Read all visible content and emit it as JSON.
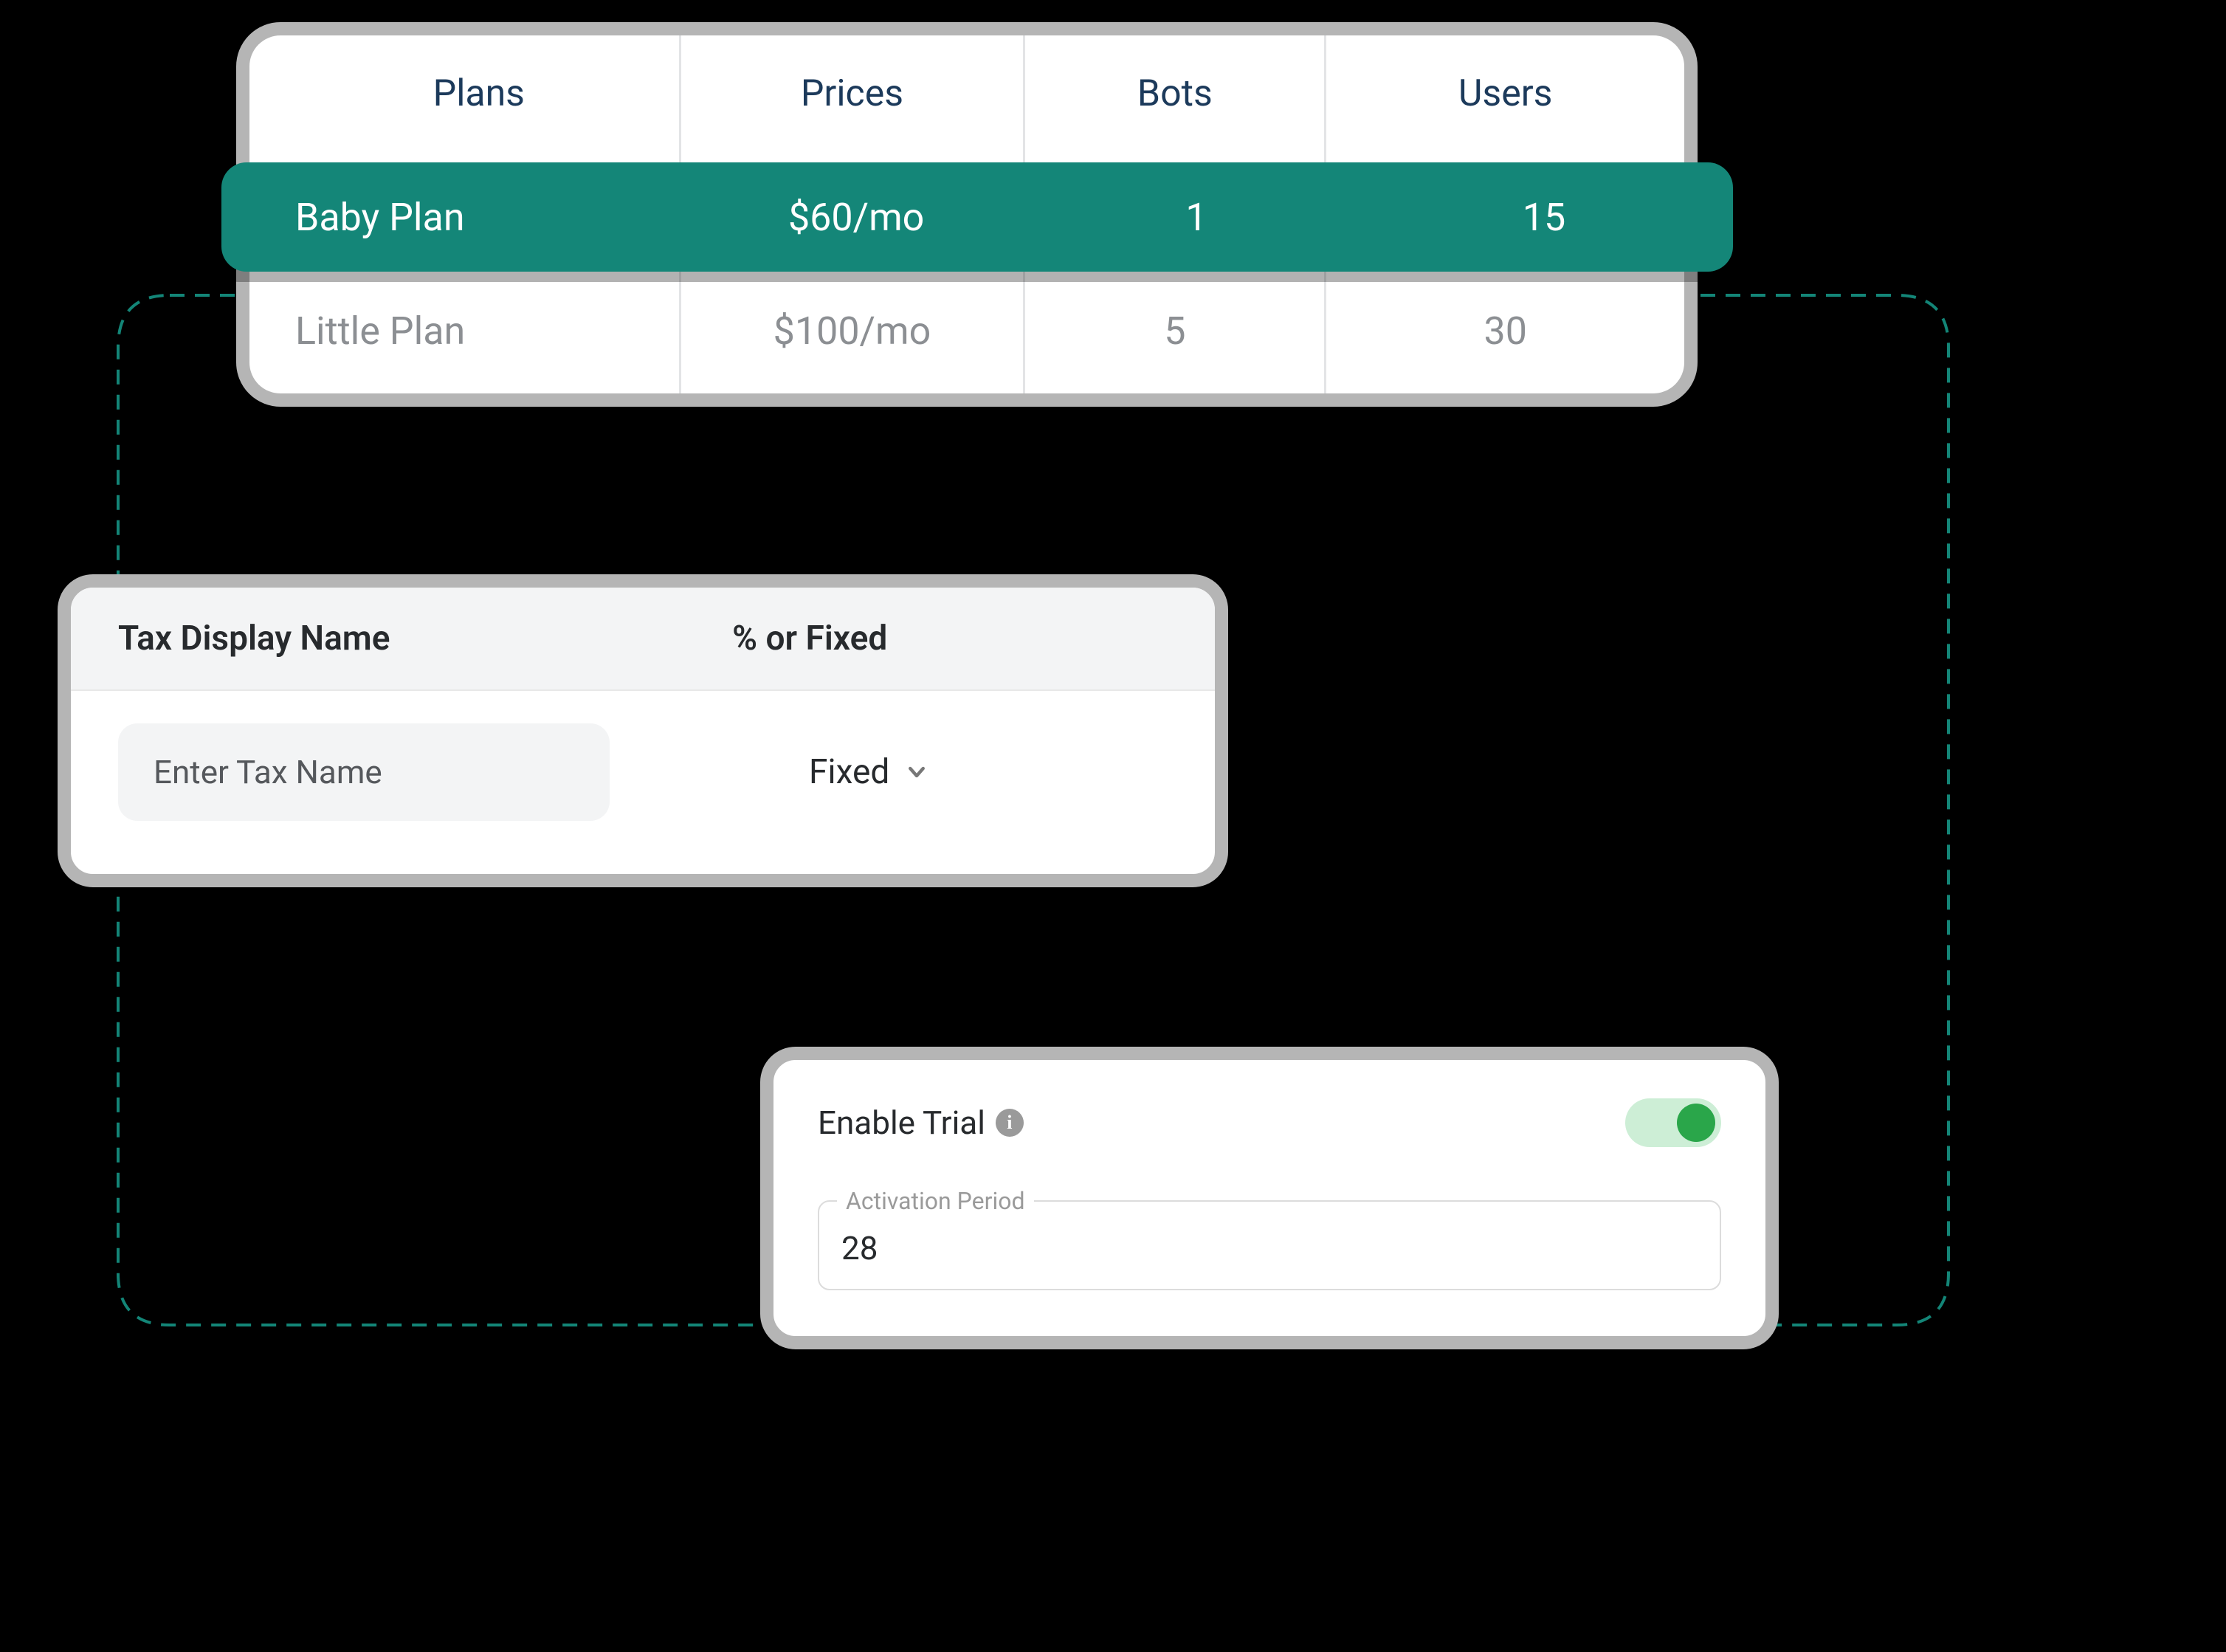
{
  "plans_table": {
    "headers": [
      "Plans",
      "Prices",
      "Bots",
      "Users"
    ],
    "rows": [
      {
        "name": "Baby Plan",
        "price": "$60/mo",
        "bots": "1",
        "users": "15",
        "selected": true
      },
      {
        "name": "Little Plan",
        "price": "$100/mo",
        "bots": "5",
        "users": "30",
        "selected": false
      }
    ]
  },
  "tax_panel": {
    "header_name": "Tax Display Name",
    "header_type": "% or Fixed",
    "name_placeholder": "Enter Tax Name",
    "type_selected": "Fixed"
  },
  "trial_panel": {
    "label": "Enable Trial",
    "toggle_on": true,
    "activation_legend": "Activation Period",
    "activation_value": "28"
  }
}
